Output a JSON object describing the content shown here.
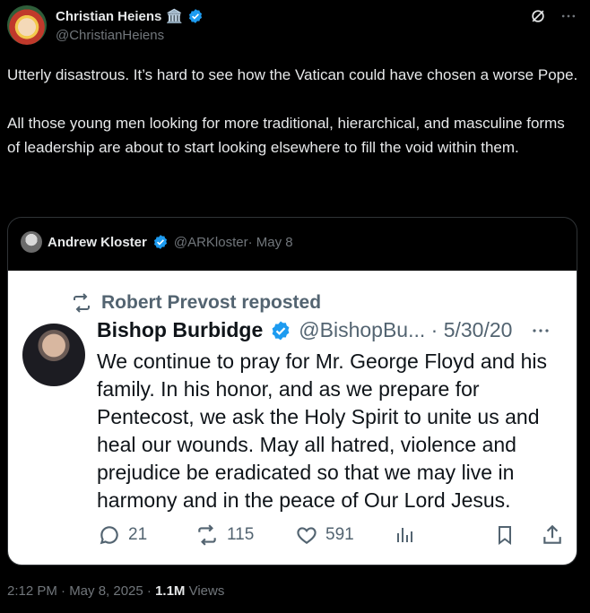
{
  "post": {
    "author_name": "Christian Heiens",
    "author_emoji": "🏛️",
    "author_handle": "@ChristianHeiens",
    "text_p1": "Utterly disastrous. It’s hard to see how the Vatican could have chosen a worse Pope.",
    "text_p2": "All those young men looking for more traditional, hierarchical, and masculine forms of leadership are about to start looking elsewhere to fill the void within them.",
    "timestamp": "2:12 PM · May 8, 2025 · ",
    "views_count": "1.1M",
    "views_label": " Views"
  },
  "quote": {
    "author_name": "Andrew Kloster",
    "author_handle": "@ARKloster",
    "date": " · May 8"
  },
  "screenshot": {
    "repost_label": "Robert Prevost reposted",
    "author_name": "Bishop Burbidge",
    "author_handle": "@BishopBu... · 5/30/20",
    "text": "We continue to pray for Mr. George Floyd and his family. In his honor, and as we prepare for Pentecost, we ask the Holy Spirit to unite us and heal our wounds. May all hatred, violence and prejudice be eradicated so that we may live in harmony and in the peace of Our Lord Jesus.",
    "replies": "21",
    "reposts": "115",
    "likes": "591"
  },
  "colors": {
    "background": "#000000",
    "verified": "#1d9bf0",
    "muted": "#71767b"
  }
}
